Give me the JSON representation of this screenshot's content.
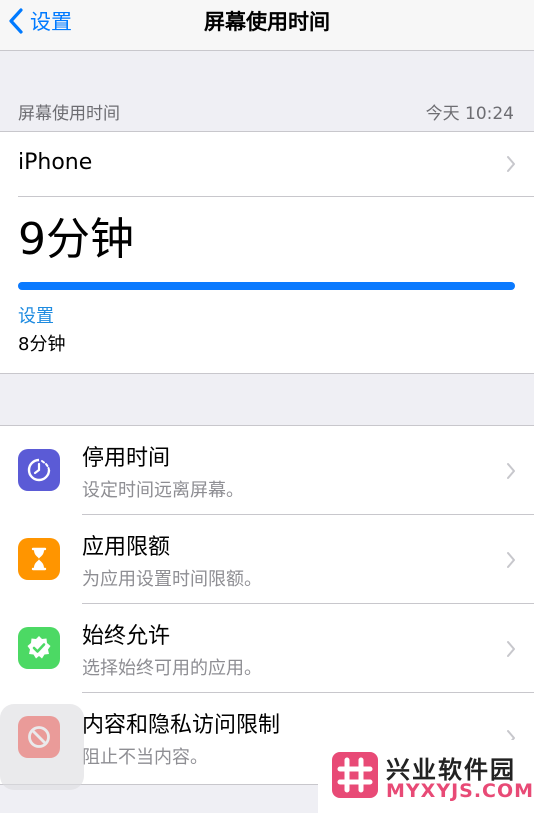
{
  "navbar": {
    "back_label": "设置",
    "title": "屏幕使用时间"
  },
  "usage": {
    "section_label": "屏幕使用时间",
    "timestamp": "今天 10:24",
    "device": "iPhone",
    "total": "9分钟",
    "bar_fill_fraction": 1.0,
    "bar_color": "#0a7aff",
    "category_label": "设置",
    "category_value": "8分钟"
  },
  "menu": [
    {
      "title": "停用时间",
      "subtitle": "设定时间远离屏幕。",
      "icon": "downtime-icon",
      "color": "#5b5bd6"
    },
    {
      "title": "应用限额",
      "subtitle": "为应用设置时间限额。",
      "icon": "hourglass-icon",
      "color": "#ff9500"
    },
    {
      "title": "始终允许",
      "subtitle": "选择始终可用的应用。",
      "icon": "checkmark-badge-icon",
      "color": "#4cd964"
    },
    {
      "title": "内容和隐私访问限制",
      "subtitle": "阻止不当内容。",
      "icon": "restriction-icon",
      "color": "#ff3b30"
    }
  ],
  "watermark": {
    "text": "兴业软件园",
    "url": "MYXYJS.COM"
  }
}
